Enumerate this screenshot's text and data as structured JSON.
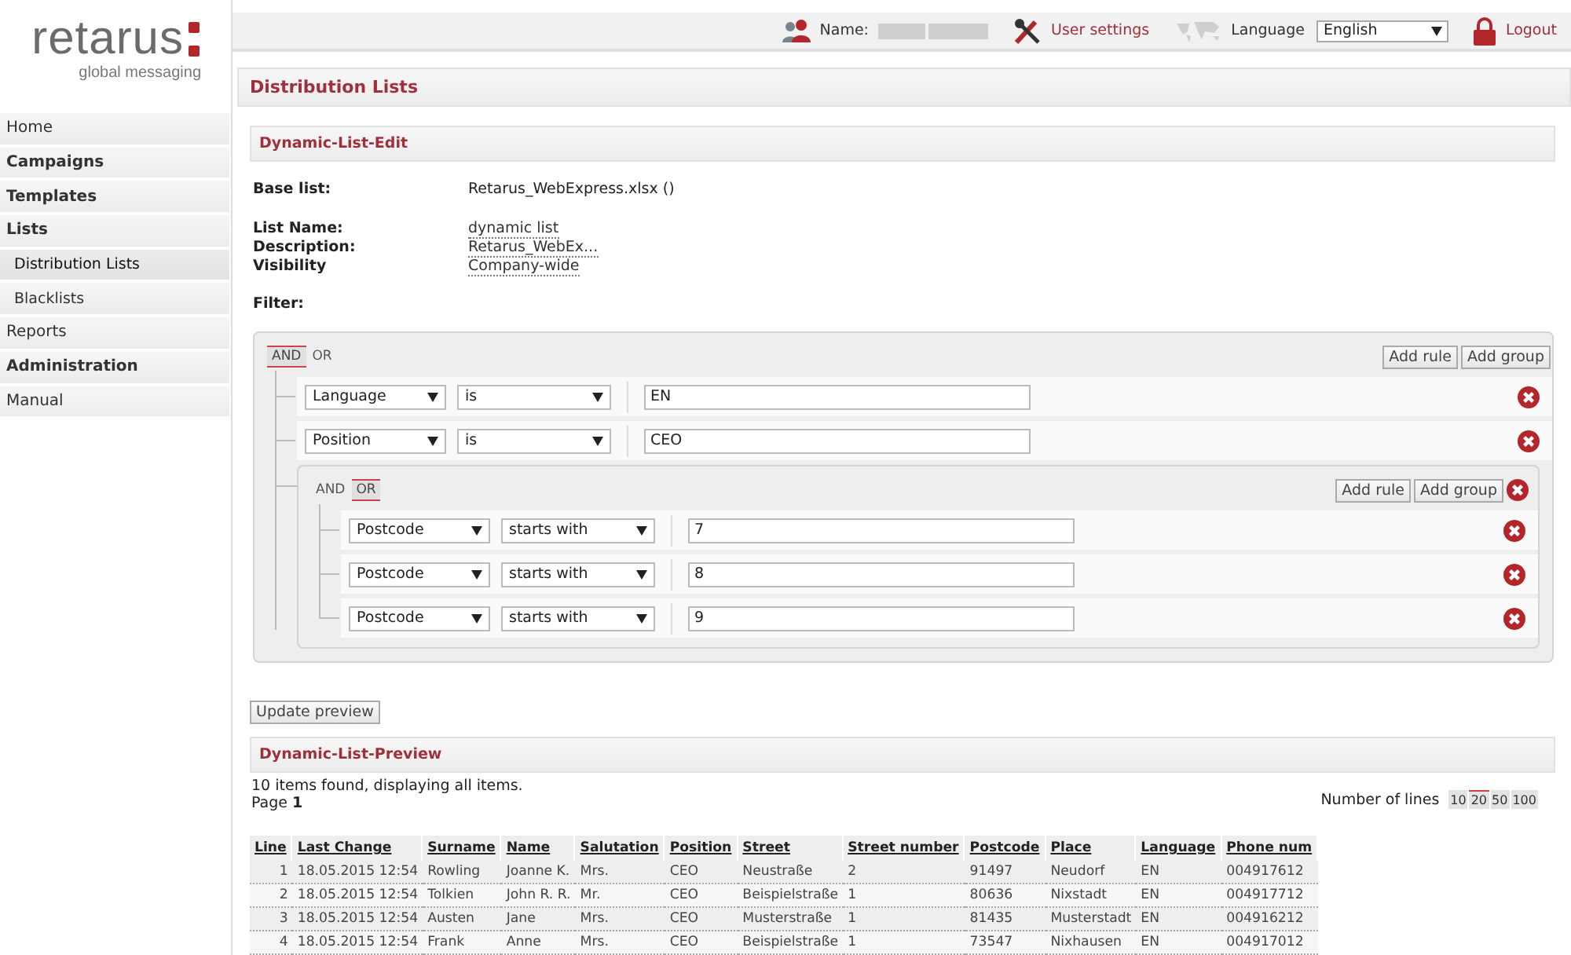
{
  "logo": {
    "name": "retarus",
    "tagline": "global messaging"
  },
  "topbar": {
    "name_label": "Name:",
    "user_settings": "User settings",
    "language_label": "Language",
    "language": "English",
    "logout": "Logout"
  },
  "sidebar": {
    "items": [
      {
        "label": "Home",
        "kind": "link",
        "selected": false
      },
      {
        "label": "Campaigns",
        "kind": "section",
        "selected": false
      },
      {
        "label": "Templates",
        "kind": "section",
        "selected": false
      },
      {
        "label": "Lists",
        "kind": "section",
        "selected": false
      },
      {
        "label": "Distribution Lists",
        "kind": "subitem",
        "selected": true
      },
      {
        "label": "Blacklists",
        "kind": "subitem",
        "selected": false
      },
      {
        "label": "Reports",
        "kind": "link",
        "selected": false
      },
      {
        "label": "Administration",
        "kind": "section",
        "selected": false
      },
      {
        "label": "Manual",
        "kind": "link",
        "selected": false
      }
    ]
  },
  "page_title": "Distribution Lists",
  "edit_panel": {
    "title": "Dynamic-List-Edit",
    "base_list": {
      "label": "Base list:",
      "value": "Retarus_WebExpress.xlsx ()"
    },
    "properties": [
      {
        "label": "List Name:",
        "value": "dynamic list"
      },
      {
        "label": "Description:",
        "value": "Retarus_WebEx..."
      },
      {
        "label": "Visibility",
        "value": "Company-wide"
      }
    ],
    "filter_label": "Filter:",
    "filter": {
      "removable": false,
      "connectors": [
        {
          "label": "AND",
          "selected": true
        },
        {
          "label": "OR",
          "selected": false
        }
      ],
      "actions": [
        "Add rule",
        "Add group"
      ],
      "rules": [
        {
          "kind": "rule",
          "field": "Language",
          "operator": "is",
          "value": "EN"
        },
        {
          "kind": "rule",
          "field": "Position",
          "operator": "is",
          "value": "CEO"
        },
        {
          "kind": "group",
          "removable": true,
          "connectors": [
            {
              "label": "AND",
              "selected": false
            },
            {
              "label": "OR",
              "selected": true
            }
          ],
          "actions": [
            "Add rule",
            "Add group"
          ],
          "rules": [
            {
              "kind": "rule",
              "field": "Postcode",
              "operator": "starts with",
              "value": "7"
            },
            {
              "kind": "rule",
              "field": "Postcode",
              "operator": "starts with",
              "value": "8"
            },
            {
              "kind": "rule",
              "field": "Postcode",
              "operator": "starts with",
              "value": "9"
            }
          ]
        }
      ]
    },
    "update_button": "Update preview"
  },
  "preview": {
    "title": "Dynamic-List-Preview",
    "summary": "10 items found, displaying all items.",
    "page_label": "Page",
    "page": "1",
    "lines_label": "Number of lines",
    "page_sizes": [
      {
        "label": "10",
        "selected": false
      },
      {
        "label": "20",
        "selected": true
      },
      {
        "label": "50",
        "selected": false
      },
      {
        "label": "100",
        "selected": false
      }
    ],
    "table": {
      "columns": [
        "Line",
        "Last Change",
        "Surname",
        "Name",
        "Salutation",
        "Position",
        "Street",
        "Street number",
        "Postcode",
        "Place",
        "Language",
        "Phone num"
      ],
      "rows": [
        [
          "1",
          "18.05.2015 12:54",
          "Rowling",
          "Joanne K.",
          "Mrs.",
          "CEO",
          "Neustraße",
          "2",
          "91497",
          "Neudorf",
          "EN",
          "004917612"
        ],
        [
          "2",
          "18.05.2015 12:54",
          "Tolkien",
          "John R. R.",
          "Mr.",
          "CEO",
          "Beispielstraße",
          "1",
          "80636",
          "Nixstadt",
          "EN",
          "004917712"
        ],
        [
          "3",
          "18.05.2015 12:54",
          "Austen",
          "Jane",
          "Mrs.",
          "CEO",
          "Musterstraße",
          "1",
          "81435",
          "Musterstadt",
          "EN",
          "004916212"
        ],
        [
          "4",
          "18.05.2015 12:54",
          "Frank",
          "Anne",
          "Mrs.",
          "CEO",
          "Beispielstraße",
          "1",
          "73547",
          "Nixhausen",
          "EN",
          "004917012"
        ]
      ]
    }
  }
}
